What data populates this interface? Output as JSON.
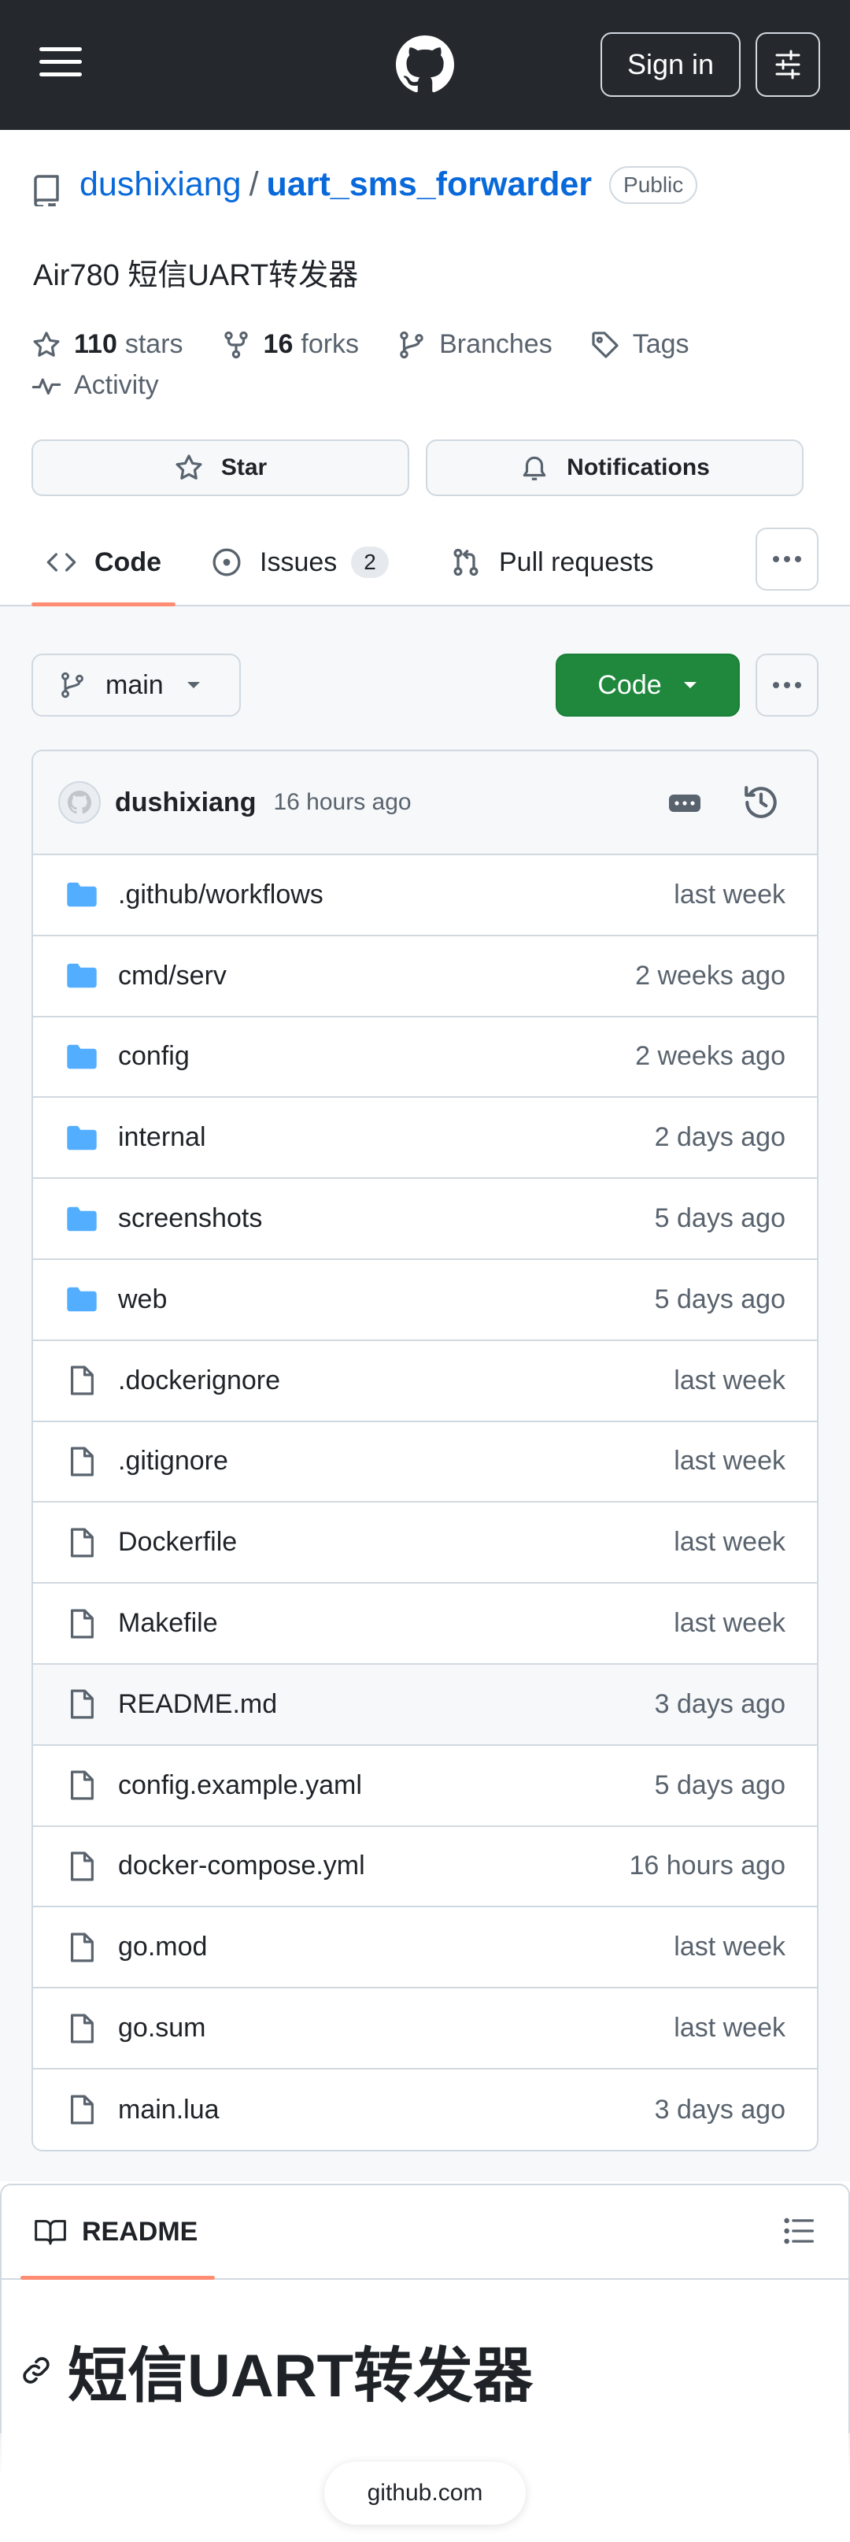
{
  "topbar": {
    "sign_in_label": "Sign in"
  },
  "repo": {
    "owner": "dushixiang",
    "separator": "/",
    "name": "uart_sms_forwarder",
    "visibility": "Public",
    "description": "Air780 短信UART转发器",
    "stars_count": "110",
    "stars_label": "stars",
    "forks_count": "16",
    "forks_label": "forks",
    "branches_label": "Branches",
    "tags_label": "Tags",
    "activity_label": "Activity"
  },
  "actions": {
    "star_label": "Star",
    "notifications_label": "Notifications"
  },
  "tabs": {
    "code": "Code",
    "issues": "Issues",
    "issues_count": "2",
    "pull_requests": "Pull requests"
  },
  "branch": {
    "current": "main",
    "code_button": "Code"
  },
  "commit": {
    "author": "dushixiang",
    "time": "16 hours ago"
  },
  "files": [
    {
      "name": ".github/workflows",
      "age": "last week",
      "type": "folder"
    },
    {
      "name": "cmd/serv",
      "age": "2 weeks ago",
      "type": "folder"
    },
    {
      "name": "config",
      "age": "2 weeks ago",
      "type": "folder"
    },
    {
      "name": "internal",
      "age": "2 days ago",
      "type": "folder"
    },
    {
      "name": "screenshots",
      "age": "5 days ago",
      "type": "folder"
    },
    {
      "name": "web",
      "age": "5 days ago",
      "type": "folder"
    },
    {
      "name": ".dockerignore",
      "age": "last week",
      "type": "file"
    },
    {
      "name": ".gitignore",
      "age": "last week",
      "type": "file"
    },
    {
      "name": "Dockerfile",
      "age": "last week",
      "type": "file"
    },
    {
      "name": "Makefile",
      "age": "last week",
      "type": "file"
    },
    {
      "name": "README.md",
      "age": "3 days ago",
      "type": "file"
    },
    {
      "name": "config.example.yaml",
      "age": "5 days ago",
      "type": "file"
    },
    {
      "name": "docker-compose.yml",
      "age": "16 hours ago",
      "type": "file"
    },
    {
      "name": "go.mod",
      "age": "last week",
      "type": "file"
    },
    {
      "name": "go.sum",
      "age": "last week",
      "type": "file"
    },
    {
      "name": "main.lua",
      "age": "3 days ago",
      "type": "file"
    }
  ],
  "readme": {
    "tab_label": "README",
    "heading": "短信UART转发器"
  },
  "browser": {
    "url": "github.com"
  },
  "colors": {
    "topbar_bg": "#25292e",
    "link": "#0969da",
    "folder": "#54aeff",
    "primary_button": "#1f883d",
    "tab_underline": "#fd8c73"
  }
}
